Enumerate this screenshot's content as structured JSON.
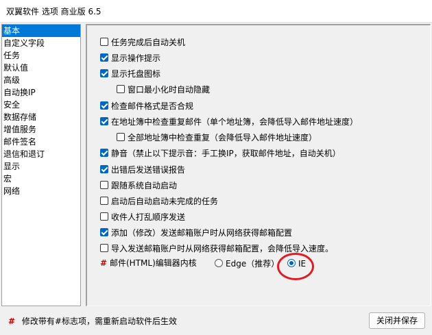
{
  "window": {
    "title": "双翼软件 选项 商业版 6.5"
  },
  "sidebar": {
    "items": [
      {
        "label": "基本"
      },
      {
        "label": "自定义字段"
      },
      {
        "label": "任务"
      },
      {
        "label": "默认值"
      },
      {
        "label": "高级"
      },
      {
        "label": "自动换IP"
      },
      {
        "label": "安全"
      },
      {
        "label": "数据存储"
      },
      {
        "label": "增值服务"
      },
      {
        "label": "邮件签名"
      },
      {
        "label": "退信和退订"
      },
      {
        "label": "显示"
      },
      {
        "label": "宏"
      },
      {
        "label": "网络"
      }
    ],
    "selected": "基本"
  },
  "options": [
    {
      "label": "任务完成后自动关机",
      "checked": false
    },
    {
      "label": "显示操作提示",
      "checked": true
    },
    {
      "label": "显示托盘图标",
      "checked": true
    },
    {
      "label": "窗口最小化时自动隐藏",
      "checked": false
    },
    {
      "label": "检查邮件格式是否合规",
      "checked": true
    },
    {
      "label": "在地址簿中检查重复邮件（单个地址簿，会降低导入邮件地址速度）",
      "checked": true
    },
    {
      "label": "全部地址簿中检查重复（会降低导入邮件地址速度）",
      "checked": false
    },
    {
      "label": "静音（禁止以下提示音：手工换IP，获取邮件地址，自动关机）",
      "checked": true
    },
    {
      "label": "出错后发送错误报告",
      "checked": true
    },
    {
      "label": "跟随系统自动启动",
      "checked": false
    },
    {
      "label": "启动后自动启动未完成的任务",
      "checked": false
    },
    {
      "label": "收件人打乱顺序发送",
      "checked": false
    },
    {
      "label": "添加（修改）发送邮箱账户时从网络获得邮箱配置",
      "checked": true
    },
    {
      "label": "导入发送邮箱账户时从网络获得邮箱配置，会降低导入速度。",
      "checked": false
    }
  ],
  "kernel": {
    "marker": "#",
    "label": "邮件(HTML)编辑器内核",
    "choices": [
      {
        "label": "Edge（推荐）",
        "selected": false
      },
      {
        "label": "IE",
        "selected": true
      }
    ]
  },
  "footer": {
    "marker": "#",
    "note": "修改带有#标志项，需重新启动软件后生效",
    "close_save_label": "关闭并保存"
  },
  "colors": {
    "accent": "#0067c0",
    "selection": "#0078d7",
    "marker": "#cc0000",
    "annotation": "#e01b24"
  }
}
